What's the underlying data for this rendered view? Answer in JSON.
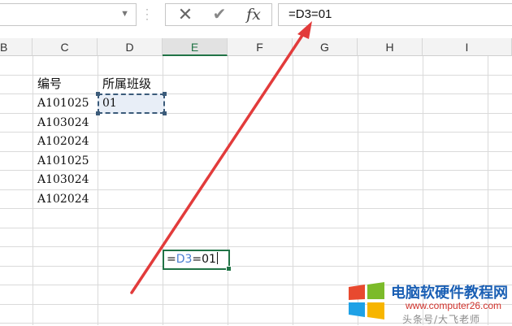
{
  "formula_bar": {
    "formula": "=D3=01",
    "cancel_symbol": "✕",
    "enter_symbol": "✔",
    "fx_symbol": "fx"
  },
  "columns": [
    {
      "label": "B",
      "active": false
    },
    {
      "label": "C",
      "active": false
    },
    {
      "label": "D",
      "active": false
    },
    {
      "label": "E",
      "active": true
    },
    {
      "label": "F",
      "active": false
    },
    {
      "label": "G",
      "active": false
    },
    {
      "label": "H",
      "active": false
    },
    {
      "label": "I",
      "active": false
    }
  ],
  "cells": {
    "c_header": "编号",
    "d_header": "所属班级",
    "c_values": [
      "A101025",
      "A103024",
      "A102024",
      "A101025",
      "A103024",
      "A102024"
    ],
    "d_first": "01"
  },
  "edit_cell": {
    "prefix": "=",
    "ref": "D3",
    "suffix": "=01"
  },
  "annotation": {
    "arrow_color": "#e23b3b"
  },
  "watermark": {
    "title": "电脑软硬件教程网",
    "url": "www.computer26.com",
    "credit": "头条号/大飞老师",
    "logo_colors": [
      "#e8492f",
      "#7cbb2a",
      "#1ea1e6",
      "#f7b500"
    ]
  }
}
